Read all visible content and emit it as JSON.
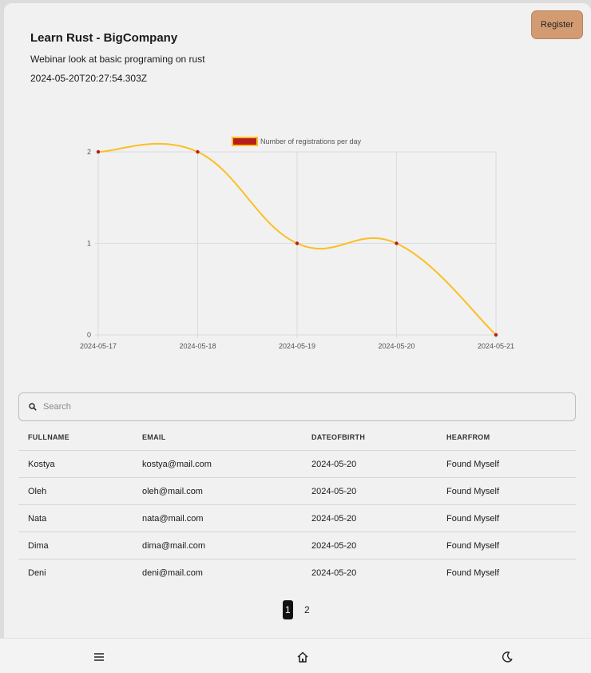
{
  "header": {
    "title": "Learn Rust - BigCompany",
    "description": "Webinar look at basic programing on rust",
    "datetime": "2024-05-20T20:27:54.303Z",
    "register_label": "Register"
  },
  "chart_data": {
    "type": "line",
    "x": [
      "2024-05-17",
      "2024-05-18",
      "2024-05-19",
      "2024-05-20",
      "2024-05-21"
    ],
    "series": [
      {
        "name": "Number of registrations per day",
        "values": [
          2,
          2,
          1,
          1,
          0
        ],
        "color": "#fbbf24",
        "point_color": "#b91c1c"
      }
    ],
    "ylim": [
      0,
      2
    ],
    "yticks": [
      "0",
      "1",
      "2"
    ],
    "legend": "top-center",
    "grid": true
  },
  "search": {
    "placeholder": "Search",
    "value": ""
  },
  "table": {
    "columns": [
      "FULLNAME",
      "EMAIL",
      "DATEOFBIRTH",
      "HEARFROM"
    ],
    "rows": [
      [
        "Kostya",
        "kostya@mail.com",
        "2024-05-20",
        "Found Myself"
      ],
      [
        "Oleh",
        "oleh@mail.com",
        "2024-05-20",
        "Found Myself"
      ],
      [
        "Nata",
        "nata@mail.com",
        "2024-05-20",
        "Found Myself"
      ],
      [
        "Dima",
        "dima@mail.com",
        "2024-05-20",
        "Found Myself"
      ],
      [
        "Deni",
        "deni@mail.com",
        "2024-05-20",
        "Found Myself"
      ]
    ]
  },
  "pagination": {
    "pages": [
      "1",
      "2"
    ],
    "current": "1"
  },
  "bottom_nav": {
    "icons": [
      "menu-icon",
      "home-icon",
      "moon-icon"
    ]
  }
}
